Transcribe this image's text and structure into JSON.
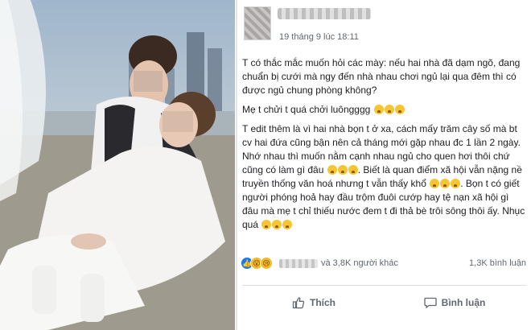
{
  "post": {
    "timestamp": "19 tháng 9 lúc 18:11",
    "paragraphs": [
      "T có thắc mắc muốn hỏi các mày: nếu hai nhà đã dạm ngõ, đang chuẩn bị cưới mà ngy đến nhà nhau chơi ngủ lại qua đêm thì có được ngủ chung phòng không?",
      "Mẹ t chửi t quá chởi luôngggg",
      "T edit thêm là vì hai nhà bọn t ở xa, cách mấy trăm cây số mà bt cv hai đứa cũng bận nên cả tháng mới gặp nhau đc 1 lần 2 ngày. Nhớ nhau thì muốn nằm cạnh nhau ngủ cho quen hơi thôi chứ cũng có làm gì đâu",
      "Biết là quan điểm xã hội vẫn nặng nề truyền thống văn hoá nhưng t vẫn thấy khổ",
      "Bọn t có giết người phóng hoả hay đầu trộm đuôi cướp hay tệ nạn xã hội gì đâu mà mẹ t chỉ thiếu nước đem t đi thả bè trôi sông thôi ấy.",
      "Nhục quá"
    ],
    "reactions": {
      "icons": [
        "like-icon",
        "wow-icon",
        "sad-icon"
      ],
      "others_text": "và 3,8K người khác",
      "comments_text": "1,3K bình luận"
    },
    "actions": {
      "like_label": "Thích",
      "comment_label": "Bình luận"
    }
  },
  "colors": {
    "facebook_blue": "#1877f2",
    "emoji_yellow": "#f7c531",
    "secondary_text": "#616770"
  }
}
